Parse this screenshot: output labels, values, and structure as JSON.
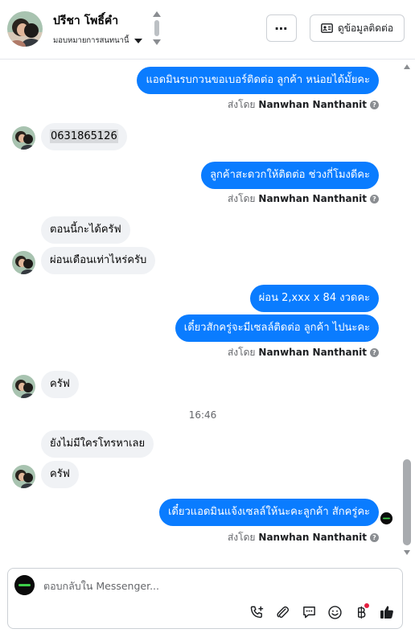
{
  "header": {
    "contact_name": "ปรีชา โพธิ์คำ",
    "assign_label": "มอบหมายการสนทนานี้",
    "contact_info_label": "ดูข้อมูลติดต่อ"
  },
  "messages": [
    {
      "side": "out",
      "text": "แอดมินรบกวนขอเบอร์ติดต่อ ลูกค้า หน่อยได้มั้ยคะ"
    },
    {
      "side": "in",
      "text": "0631865126"
    },
    {
      "side": "out",
      "text": "ลูกค้าสะดวกให้ติดต่อ ช่วงกี่โมงดีคะ"
    },
    {
      "side": "in",
      "text": "ตอนนี้กะได้ครัฟ"
    },
    {
      "side": "in",
      "text": "ผ่อนเดือนเท่าไหร่ครับ"
    },
    {
      "side": "out",
      "text": "ผ่อน 2,xxx x 84 งวดคะ"
    },
    {
      "side": "out",
      "text": "เดี๋ยวสักครู่จะมีเซลล์ติดต่อ ลูกค้า ไปนะคะ"
    },
    {
      "side": "in",
      "text": "ครัฟ"
    },
    {
      "side": "in",
      "text": "ยังไม่มีใครโทรหาเลย"
    },
    {
      "side": "in",
      "text": "ครัฟ"
    },
    {
      "side": "out",
      "text": "เดี๋ยวแอดมินแจ้งเซลล์ให้นะคะลูกค้า  สักครู่คะ"
    }
  ],
  "sent_by_prefix": "ส่งโดย",
  "sent_by_name": "Nanwhan Nanthanit",
  "timestamp": "16:46",
  "composer": {
    "placeholder": "ตอบกลับใน Messenger..."
  },
  "colors": {
    "outgoing_bubble": "#0a7cff",
    "incoming_bubble": "#f0f2f5",
    "notification_dot": "#e41e3f"
  },
  "icons": [
    "more-options-icon",
    "contact-card-icon",
    "phone-add-icon",
    "paperclip-icon",
    "message-icon",
    "emoji-icon",
    "baht-icon",
    "thumbs-up-icon",
    "info-icon"
  ]
}
